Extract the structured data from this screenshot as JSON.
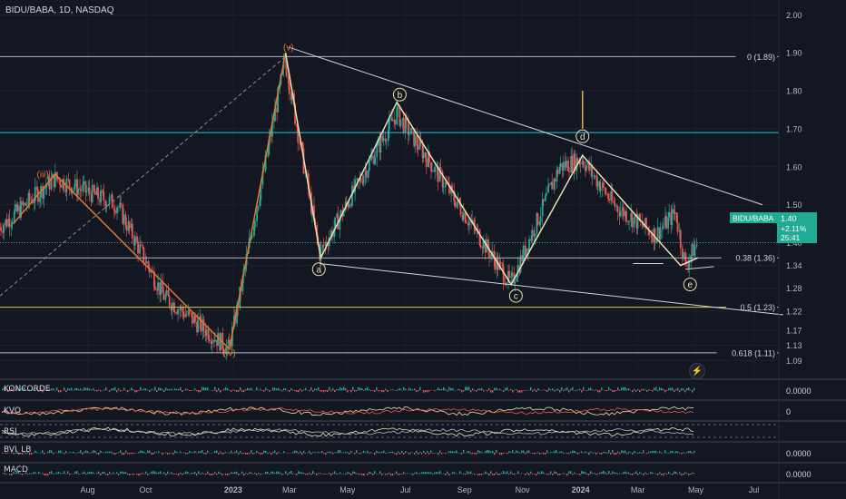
{
  "header": {
    "symbol_title": "BIDU/BABA, 1D, NASDAQ"
  },
  "price_tag": {
    "symbol": "BIDU/BABA",
    "price": "1.40",
    "change": "+2.11%",
    "countdown": "25:41"
  },
  "indicators": {
    "kong_label": "KONCORDE",
    "kvo_label": "KVO",
    "rsi_label": "RSI",
    "bvi_label": "BVI_LB",
    "macd_label": "MACD",
    "kong_value": "0.0000",
    "kvo_value": "0",
    "bvi_value": "0.0000",
    "macd_value": "0.0000"
  },
  "colors": {
    "background": "#131722",
    "up_candle": "#26a69a",
    "down_candle": "#ef5350",
    "fib_line": "#b2b5be",
    "cyan_line": "#26c6da",
    "yellow_line": "#d4c84a",
    "orange_wave": "#e07a2c",
    "cream_wave": "#e8e0b0",
    "price_tag_bg": "#22ab94"
  },
  "chart_data": {
    "type": "candlestick",
    "title": "BIDU/BABA, 1D, NASDAQ",
    "x_ticks": [
      "Aug",
      "Oct",
      "2023",
      "Mar",
      "May",
      "Jul",
      "Sep",
      "Nov",
      "2024",
      "Mar",
      "May",
      "Jul"
    ],
    "y_ticks": [
      2.0,
      1.9,
      1.8,
      1.7,
      1.6,
      1.5,
      1.4,
      1.34,
      1.28,
      1.22,
      1.17,
      1.13,
      1.09
    ],
    "ylim": [
      1.05,
      2.02
    ],
    "last_price": 1.4,
    "last_change_pct": 2.11,
    "fib_levels": [
      {
        "label": "0 (1.89)",
        "value": 1.89
      },
      {
        "label": "0.38 (1.36)",
        "value": 1.36
      },
      {
        "label": "0.5 (1.23)",
        "value": 1.23
      },
      {
        "label": "0.618 (1.11)",
        "value": 1.11
      }
    ],
    "horizontal_lines": [
      {
        "value": 1.69,
        "color": "cyan"
      }
    ],
    "wave_labels": [
      {
        "label": "(iii)",
        "date": "2022-06-15",
        "value": 1.58
      },
      {
        "label": "(iv)",
        "date": "2022-12-28",
        "value": 1.11
      },
      {
        "label": "(v)",
        "date": "2023-02-28",
        "value": 1.915
      },
      {
        "label": "a",
        "date": "2023-04-01",
        "value": 1.33
      },
      {
        "label": "b",
        "date": "2023-06-25",
        "value": 1.79
      },
      {
        "label": "c",
        "date": "2023-10-25",
        "value": 1.26
      },
      {
        "label": "d",
        "date": "2024-01-03",
        "value": 1.68
      },
      {
        "label": "e",
        "date": "2024-04-25",
        "value": 1.29
      }
    ],
    "orange_wave": [
      {
        "date": "2022-05-15",
        "value": 1.45
      },
      {
        "date": "2022-06-28",
        "value": 1.58
      },
      {
        "date": "2022-12-28",
        "value": 1.12
      },
      {
        "date": "2023-02-25",
        "value": 1.9
      }
    ],
    "cream_wave": [
      {
        "date": "2023-02-25",
        "value": 1.9
      },
      {
        "date": "2023-04-03",
        "value": 1.36
      },
      {
        "date": "2023-06-22",
        "value": 1.77
      },
      {
        "date": "2023-10-20",
        "value": 1.29
      },
      {
        "date": "2024-01-03",
        "value": 1.63
      },
      {
        "date": "2024-04-15",
        "value": 1.34
      },
      {
        "date": "2024-05-03",
        "value": 1.36
      }
    ],
    "series": [
      {
        "name": "BIDU/BABA",
        "type": "candlestick"
      },
      {
        "name": "KONCORDE",
        "type": "histogram"
      },
      {
        "name": "KVO",
        "type": "line"
      },
      {
        "name": "RSI",
        "type": "line"
      },
      {
        "name": "BVI_LB",
        "type": "histogram"
      },
      {
        "name": "MACD",
        "type": "histogram"
      }
    ]
  }
}
